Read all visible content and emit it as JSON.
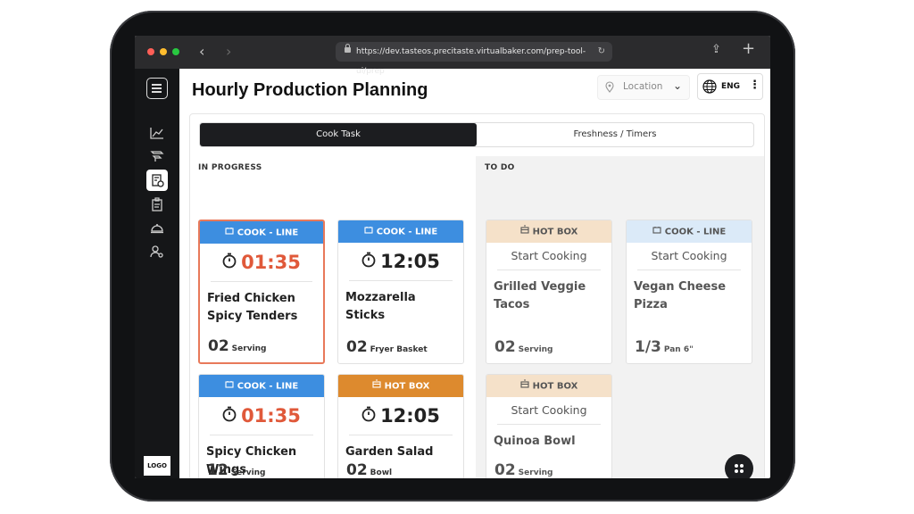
{
  "browser": {
    "url": "https://dev.tasteos.precitaste.virtualbaker.com/prep-tool-ui/prep"
  },
  "sidebar": {
    "logo": "LOGO",
    "nav": [
      {
        "icon": "chart-icon"
      },
      {
        "icon": "pipeline-icon"
      },
      {
        "icon": "prep-list-icon",
        "active": true
      },
      {
        "icon": "clipboard-icon"
      },
      {
        "icon": "cloche-icon"
      },
      {
        "icon": "users-settings-icon"
      }
    ]
  },
  "header": {
    "title": "Hourly Production Planning",
    "location_placeholder": "Location",
    "language": "ENG"
  },
  "tabs": [
    {
      "label": "Cook Task",
      "active": true
    },
    {
      "label": "Freshness / Timers",
      "active": false
    }
  ],
  "colors": {
    "cook_line": "#3d8ee0",
    "hot_box": "#dd8a2e",
    "hot_box_light": "#f5e1c9",
    "cook_line_light": "#dbeaf8",
    "timer_red": "#e0593a",
    "selected_border": "#e8795a"
  },
  "columns": {
    "in_progress": {
      "title": "IN PROGRESS",
      "cards": [
        {
          "station": "COOK - LINE",
          "timer": "01:35",
          "name": "Fried Chicken Spicy Tenders",
          "qty": "02",
          "unit": "Serving"
        },
        {
          "station": "COOK - LINE",
          "timer": "12:05",
          "name": "Mozzarella Sticks",
          "qty": "02",
          "unit": "Fryer Basket"
        },
        {
          "station": "COOK - LINE",
          "timer": "01:35",
          "name": "Spicy Chicken Wings",
          "qty": "12",
          "unit": "Serving"
        },
        {
          "station": "HOT BOX",
          "timer": "12:05",
          "name": "Garden Salad",
          "qty": "02",
          "unit": "Bowl"
        }
      ]
    },
    "to_do": {
      "title": "TO DO",
      "cards": [
        {
          "station": "HOT BOX",
          "action": "Start Cooking",
          "name": "Grilled Veggie Tacos",
          "qty": "02",
          "unit": "Serving"
        },
        {
          "station": "COOK - LINE",
          "action": "Start Cooking",
          "name": "Vegan Cheese Pizza",
          "qty": "1/3",
          "unit": "Pan 6\""
        },
        {
          "station": "HOT BOX",
          "action": "Start Cooking",
          "name": "Quinoa Bowl",
          "qty": "02",
          "unit": "Serving"
        }
      ]
    }
  }
}
